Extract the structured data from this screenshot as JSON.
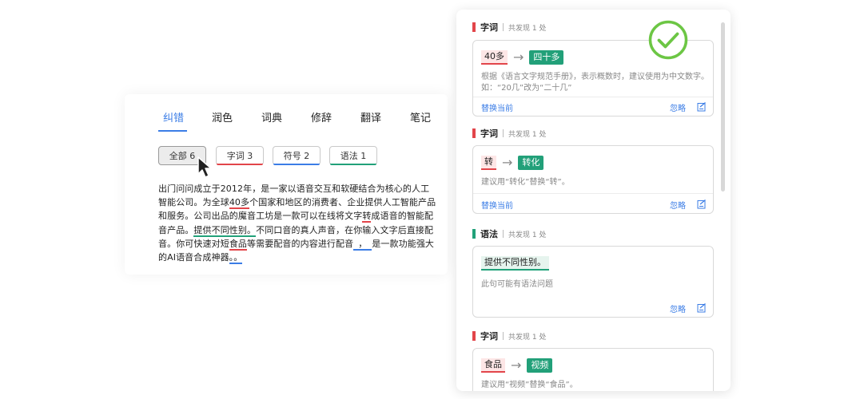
{
  "editor": {
    "tabs": [
      {
        "label": "纠错",
        "active": true
      },
      {
        "label": "润色",
        "active": false
      },
      {
        "label": "词典",
        "active": false
      },
      {
        "label": "修辞",
        "active": false
      },
      {
        "label": "翻译",
        "active": false
      },
      {
        "label": "笔记",
        "active": false
      }
    ],
    "filters": [
      {
        "label": "全部 6",
        "active": true,
        "color": ""
      },
      {
        "label": "字词 3",
        "active": false,
        "color": "#e2454a"
      },
      {
        "label": "符号 2",
        "active": false,
        "color": "#3b7de6"
      },
      {
        "label": "语法 1",
        "active": false,
        "color": "#21a179"
      }
    ],
    "text": {
      "s1": "出门问问成立于2012年，是一家以语音交互和软硬结合为核心的人工智能公司。为全球",
      "e1": "40多",
      "s2": "个国家和地区的消费者、企业提供人工智能产品和服务。公司出品的魔音工坊是一款可以在线将文字",
      "e2": "转",
      "s3": "成语音的智能配音产品。",
      "e3": "提供不同性别。",
      "s4": "不同口音的真人声音，在你输入文字后直接配音。你可快速对短",
      "e4": "食品",
      "s5": "等需要配音的内容进行配音",
      "e5": "，",
      "s6": "是一款功能强大的AI语音合成神器",
      "e6": "。。"
    }
  },
  "panel": {
    "ignore_label": "忽略",
    "replace_label": "替换当前",
    "sections": [
      {
        "category": "字词",
        "count": "共发现 1 处",
        "color": "#e2454a",
        "wrong": "40多",
        "right": "四十多",
        "desc": "根据《语言文字规范手册》，表示概数时，建议使用为中文数字。如：“20几”改为“二十几”"
      },
      {
        "category": "字词",
        "count": "共发现 1 处",
        "color": "#e2454a",
        "wrong": "转",
        "right": "转化",
        "desc": "建议用“转化”替换“转”。"
      },
      {
        "category": "语法",
        "count": "共发现 1 处",
        "color": "#21a179",
        "wrong": "提供不同性别。",
        "right": "",
        "desc": "此句可能有语法问题"
      },
      {
        "category": "字词",
        "count": "共发现 1 处",
        "color": "#e2454a",
        "wrong": "食品",
        "right": "视频",
        "desc": "建议用“视频”替换“食品”。"
      }
    ]
  },
  "colors": {
    "accent": "#3b7de6",
    "error": "#e2454a",
    "grammar": "#21a179",
    "check": "#6cc644"
  }
}
